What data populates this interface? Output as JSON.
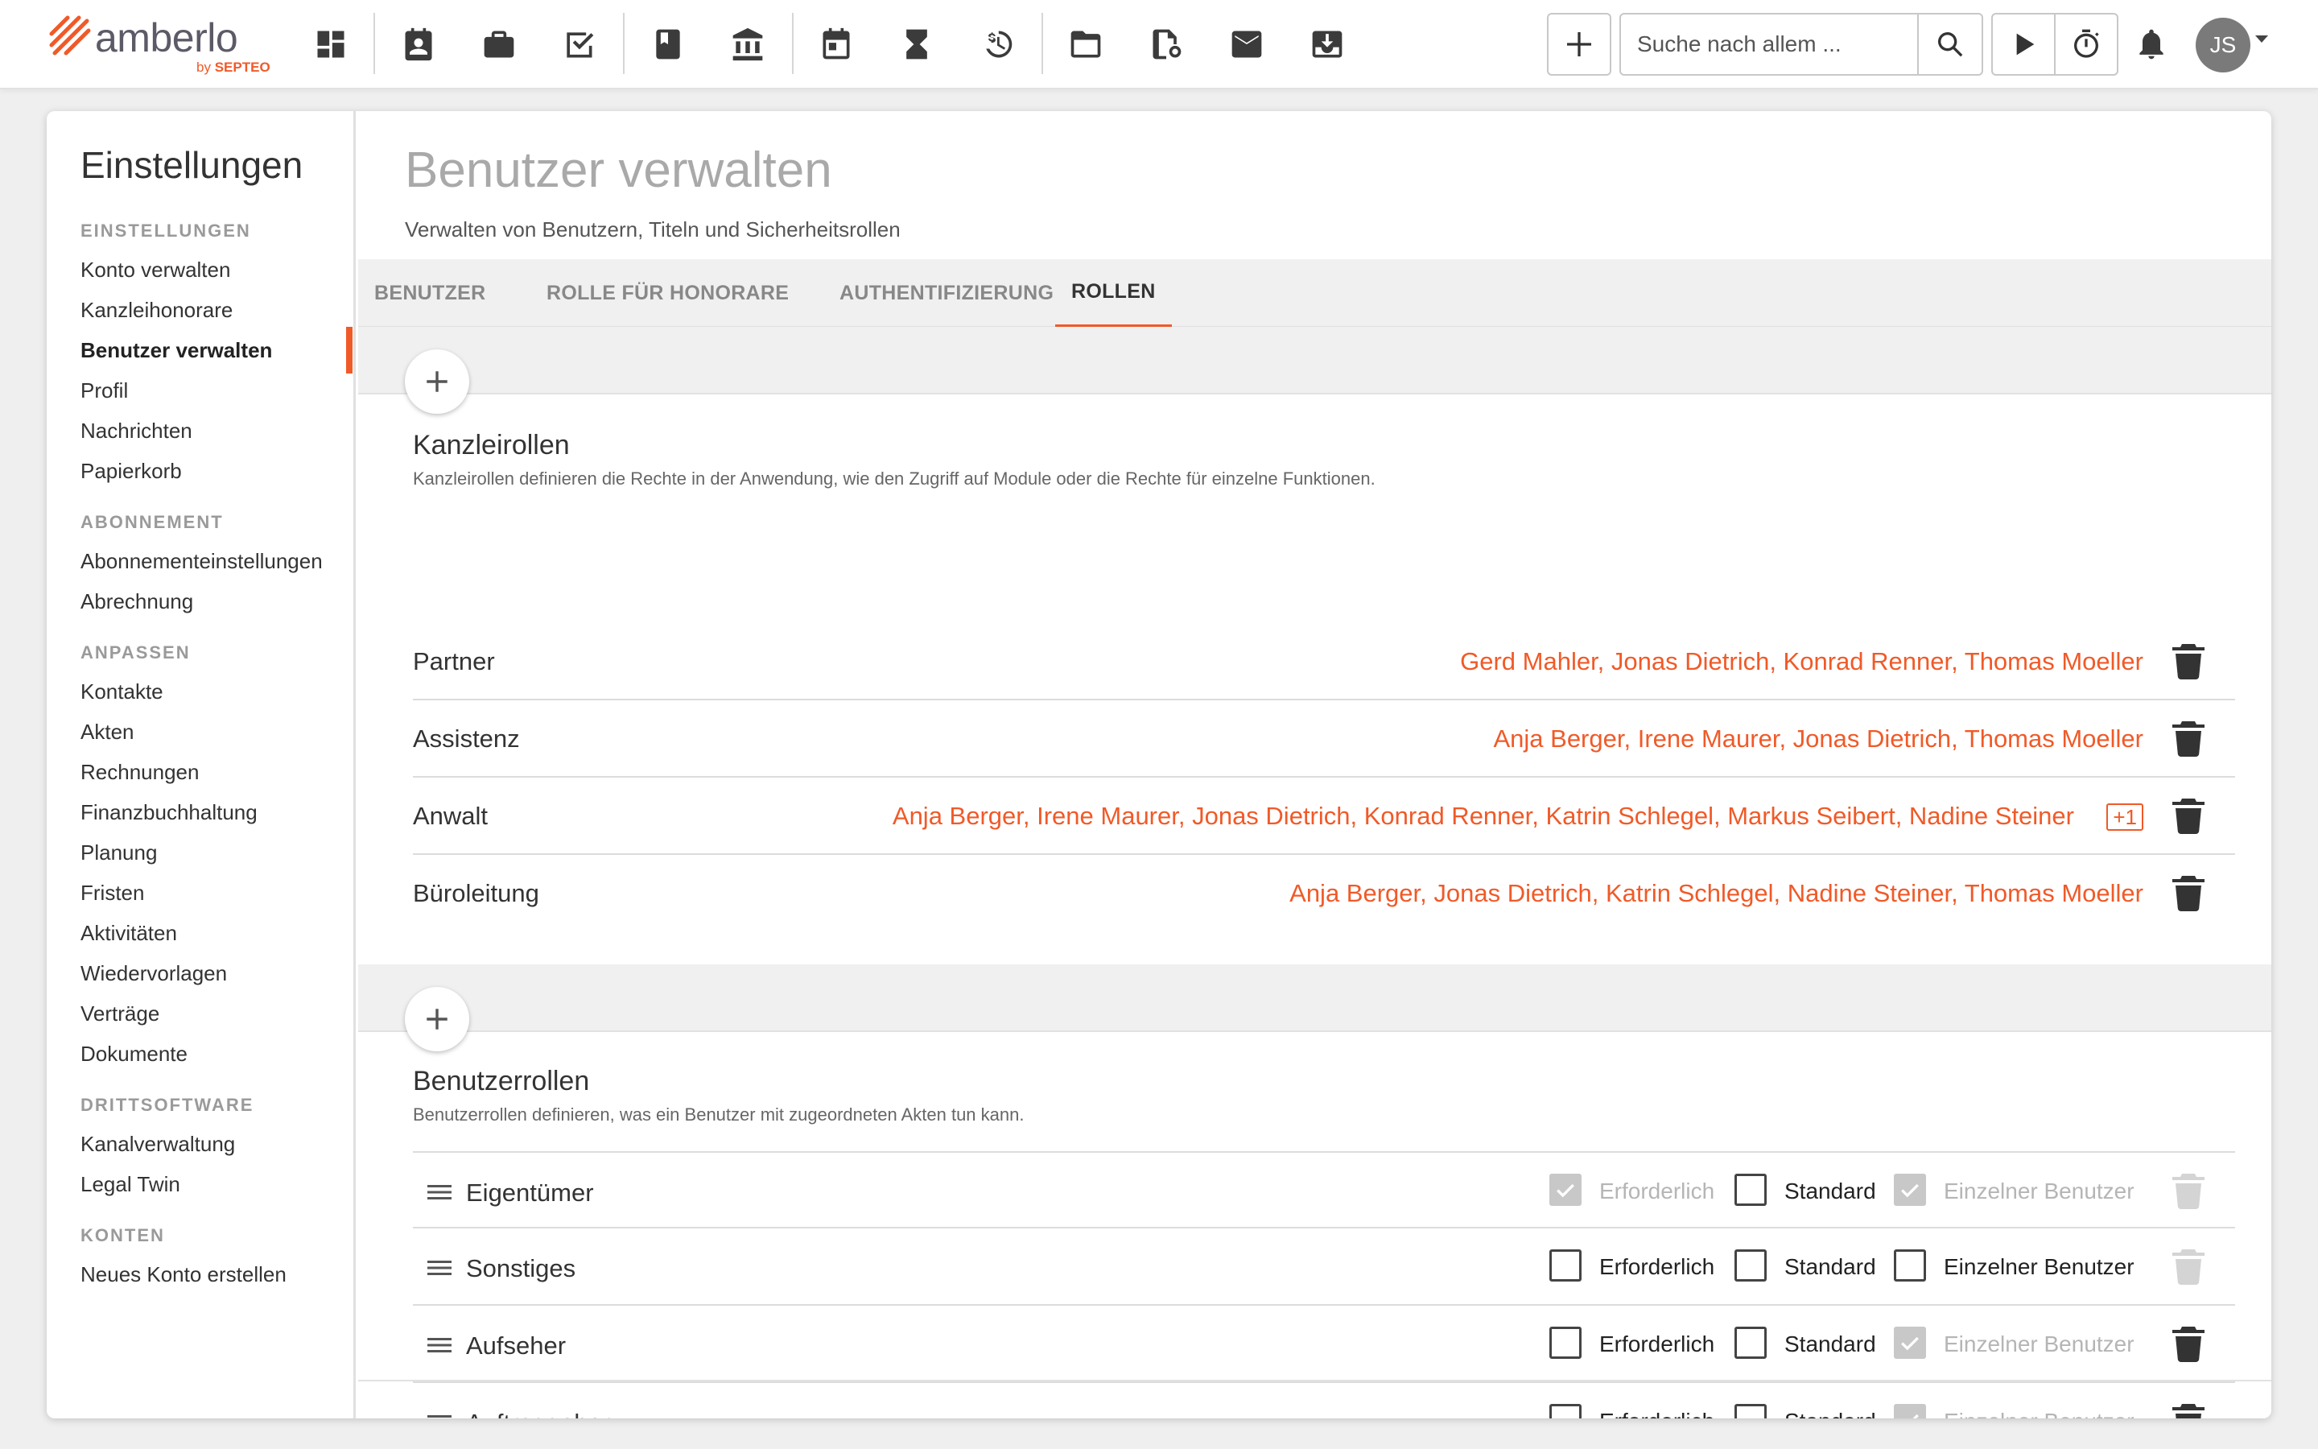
{
  "app": {
    "logo_name": "amberlo",
    "logo_by": "by",
    "logo_brand": "SEPTEO"
  },
  "nav_icons": [
    "dashboard-icon",
    "contacts-icon",
    "briefcase-icon",
    "tasks-icon",
    "book-icon",
    "bank-icon",
    "calendar-icon",
    "hourglass-icon",
    "time-money-icon",
    "folder-icon",
    "document-badge-icon",
    "mail-icon",
    "inbox-download-icon"
  ],
  "toolbar": {
    "search_placeholder": "Suche nach allem ...",
    "avatar_initials": "JS"
  },
  "sidebar": {
    "title": "Einstellungen",
    "sections": [
      {
        "label": "EINSTELLUNGEN",
        "items": [
          "Konto verwalten",
          "Kanzleihonorare",
          "Benutzer verwalten",
          "Profil",
          "Nachrichten",
          "Papierkorb"
        ]
      },
      {
        "label": "ABONNEMENT",
        "items": [
          "Abonnementeinstellungen",
          "Abrechnung"
        ]
      },
      {
        "label": "ANPASSEN",
        "items": [
          "Kontakte",
          "Akten",
          "Rechnungen",
          "Finanzbuchhaltung",
          "Planung",
          "Fristen",
          "Aktivitäten",
          "Wiedervorlagen",
          "Verträge",
          "Dokumente"
        ]
      },
      {
        "label": "DRITTSOFTWARE",
        "items": [
          "Kanalverwaltung",
          "Legal Twin"
        ]
      },
      {
        "label": "KONTEN",
        "items": [
          "Neues Konto erstellen"
        ]
      }
    ],
    "active_item": "Benutzer verwalten"
  },
  "main": {
    "title": "Benutzer verwalten",
    "subtitle": "Verwalten von Benutzern, Titeln und Sicherheitsrollen",
    "tabs": [
      "BENUTZER",
      "ROLLE FÜR HONORARE",
      "AUTHENTIFIZIERUNG",
      "ROLLEN"
    ],
    "active_tab": "ROLLEN"
  },
  "kanzleirollen": {
    "title": "Kanzleirollen",
    "description": "Kanzleirollen definieren die Rechte in der Anwendung, wie den Zugriff auf Module oder die Rechte für einzelne Funktionen.",
    "rows": [
      {
        "name": "Partner",
        "members": "Gerd Mahler, Jonas Dietrich, Konrad Renner, Thomas Moeller",
        "more": ""
      },
      {
        "name": "Assistenz",
        "members": "Anja Berger, Irene Maurer, Jonas Dietrich, Thomas Moeller",
        "more": ""
      },
      {
        "name": "Anwalt",
        "members": "Anja Berger, Irene Maurer, Jonas Dietrich, Konrad Renner, Katrin Schlegel, Markus Seibert, Nadine Steiner",
        "more": "+1"
      },
      {
        "name": "Büroleitung",
        "members": "Anja Berger, Jonas Dietrich, Katrin Schlegel, Nadine Steiner, Thomas Moeller",
        "more": ""
      }
    ]
  },
  "benutzerrollen": {
    "title": "Benutzerrollen",
    "description": "Benutzerrollen definieren, was ein Benutzer mit zugeordneten Akten tun kann.",
    "labels": {
      "required": "Erforderlich",
      "standard": "Standard",
      "single": "Einzelner Benutzer"
    },
    "rows": [
      {
        "name": "Eigentümer",
        "required": true,
        "required_disabled": true,
        "standard": false,
        "single": true,
        "single_disabled": true,
        "delete_disabled": true
      },
      {
        "name": "Sonstiges",
        "required": false,
        "required_disabled": false,
        "standard": false,
        "single": false,
        "single_disabled": false,
        "delete_disabled": true
      },
      {
        "name": "Aufseher",
        "required": false,
        "required_disabled": false,
        "standard": false,
        "single": true,
        "single_disabled": true,
        "delete_disabled": false
      },
      {
        "name": "Auftraggeber",
        "required": false,
        "required_disabled": false,
        "standard": false,
        "single": true,
        "single_disabled": true,
        "delete_disabled": false
      }
    ]
  },
  "colors": {
    "accent": "#f05a28",
    "text": "#333333",
    "muted": "#9a9a9a"
  }
}
